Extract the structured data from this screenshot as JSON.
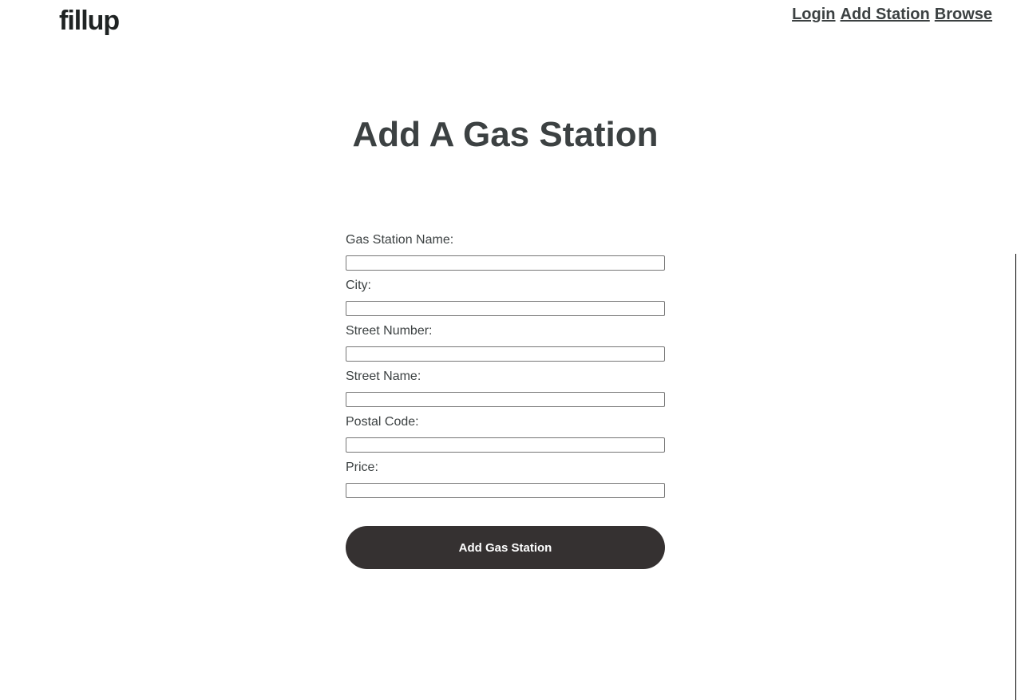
{
  "header": {
    "logo": "fillup",
    "nav": [
      {
        "label": "Login"
      },
      {
        "label": "Add Station"
      },
      {
        "label": "Browse"
      }
    ]
  },
  "main": {
    "title": "Add A Gas Station",
    "fields": [
      {
        "label": "Gas Station Name:",
        "value": "",
        "placeholder": ""
      },
      {
        "label": "City:",
        "value": "",
        "placeholder": ""
      },
      {
        "label": "Street Number:",
        "value": "",
        "placeholder": ""
      },
      {
        "label": "Street Name:",
        "value": "",
        "placeholder": ""
      },
      {
        "label": "Postal Code:",
        "value": "",
        "placeholder": ""
      },
      {
        "label": "Price:",
        "value": "",
        "placeholder": ""
      }
    ],
    "submit_label": "Add Gas Station"
  },
  "colors": {
    "text": "#3c4142",
    "logo": "#1f2323",
    "button_bg": "#353131",
    "button_text": "#ffffff"
  }
}
